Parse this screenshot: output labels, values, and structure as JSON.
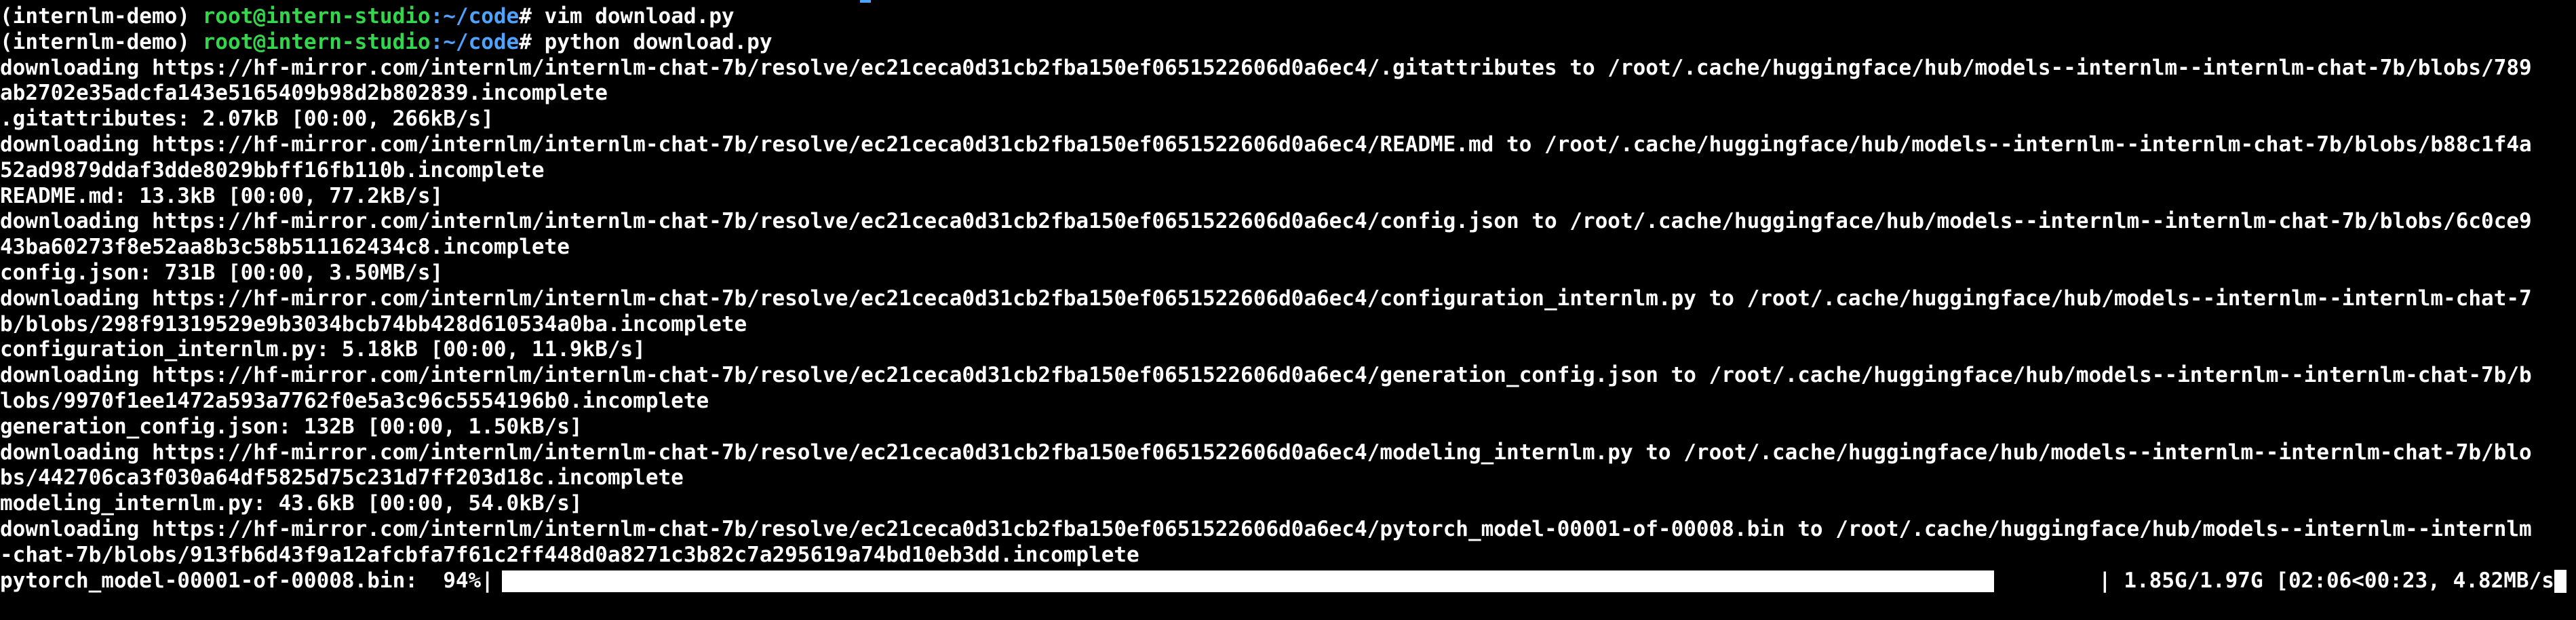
{
  "colors": {
    "background": "#000000",
    "text": "#ffffff",
    "prompt_user": "#32d74b",
    "prompt_path": "#4fa3ff"
  },
  "prompt": {
    "env": "(internlm-demo) ",
    "user_host": "root@intern-studio",
    "path": ":~/code",
    "symbol": "# "
  },
  "commands": [
    "vim download.py",
    "python download.py"
  ],
  "output_lines": [
    "downloading https://hf-mirror.com/internlm/internlm-chat-7b/resolve/ec21ceca0d31cb2fba150ef0651522606d0a6ec4/.gitattributes to /root/.cache/huggingface/hub/models--internlm--internlm-chat-7b/blobs/789",
    "ab2702e35adcfa143e5165409b98d2b802839.incomplete",
    ".gitattributes: 2.07kB [00:00, 266kB/s]",
    "downloading https://hf-mirror.com/internlm/internlm-chat-7b/resolve/ec21ceca0d31cb2fba150ef0651522606d0a6ec4/README.md to /root/.cache/huggingface/hub/models--internlm--internlm-chat-7b/blobs/b88c1f4a",
    "52ad9879ddaf3dde8029bbff16fb110b.incomplete",
    "README.md: 13.3kB [00:00, 77.2kB/s]",
    "downloading https://hf-mirror.com/internlm/internlm-chat-7b/resolve/ec21ceca0d31cb2fba150ef0651522606d0a6ec4/config.json to /root/.cache/huggingface/hub/models--internlm--internlm-chat-7b/blobs/6c0ce9",
    "43ba60273f8e52aa8b3c58b511162434c8.incomplete",
    "config.json: 731B [00:00, 3.50MB/s]",
    "downloading https://hf-mirror.com/internlm/internlm-chat-7b/resolve/ec21ceca0d31cb2fba150ef0651522606d0a6ec4/configuration_internlm.py to /root/.cache/huggingface/hub/models--internlm--internlm-chat-7",
    "b/blobs/298f91319529e9b3034bcb74bb428d610534a0ba.incomplete",
    "configuration_internlm.py: 5.18kB [00:00, 11.9kB/s]",
    "downloading https://hf-mirror.com/internlm/internlm-chat-7b/resolve/ec21ceca0d31cb2fba150ef0651522606d0a6ec4/generation_config.json to /root/.cache/huggingface/hub/models--internlm--internlm-chat-7b/b",
    "lobs/9970f1ee1472a593a7762f0e5a3c96c5554196b0.incomplete",
    "generation_config.json: 132B [00:00, 1.50kB/s]",
    "downloading https://hf-mirror.com/internlm/internlm-chat-7b/resolve/ec21ceca0d31cb2fba150ef0651522606d0a6ec4/modeling_internlm.py to /root/.cache/huggingface/hub/models--internlm--internlm-chat-7b/blo",
    "bs/442706ca3f030a64df5825d75c231d7ff203d18c.incomplete",
    "modeling_internlm.py: 43.6kB [00:00, 54.0kB/s]",
    "downloading https://hf-mirror.com/internlm/internlm-chat-7b/resolve/ec21ceca0d31cb2fba150ef0651522606d0a6ec4/pytorch_model-00001-of-00008.bin to /root/.cache/huggingface/hub/models--internlm--internlm",
    "-chat-7b/blobs/913fb6d43f9a12afcbfa7f61c2ff448d0a8271c3b82c7a295619a74bd10eb3dd.incomplete"
  ],
  "progress": {
    "label": "pytorch_model-00001-of-00008.bin:  94%|",
    "fraction": 0.94,
    "stats": "| 1.85G/1.97G [02:06<00:23, 4.82MB/s"
  }
}
